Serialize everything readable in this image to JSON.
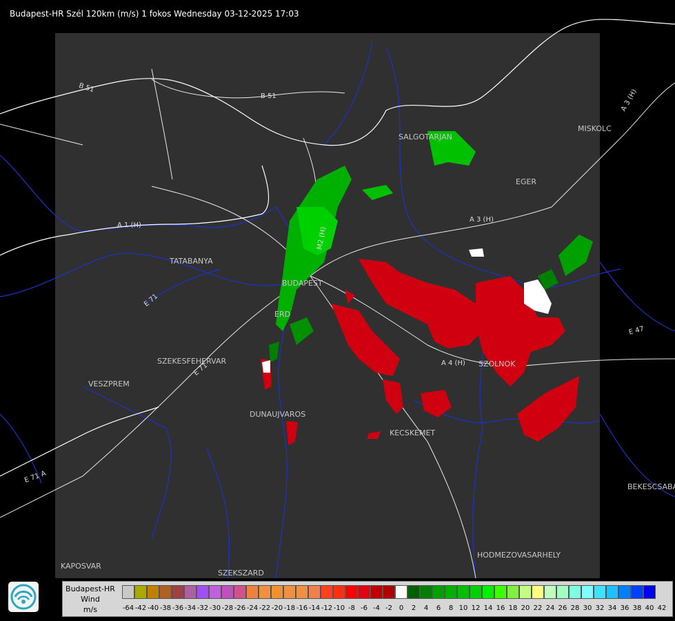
{
  "header": {
    "title": "Budapest-HR Szél 120km (m/s) 1 fokos Wednesday 03-12-2025 17:03"
  },
  "cities": [
    {
      "name": "SALGOTARJAN"
    },
    {
      "name": "EGER"
    },
    {
      "name": "MISKOLC"
    },
    {
      "name": "TATABANYA"
    },
    {
      "name": "BUDAPEST"
    },
    {
      "name": "ERD"
    },
    {
      "name": "SZEKESFEHERVAR"
    },
    {
      "name": "VESZPREM"
    },
    {
      "name": "DUNAUJVAROS"
    },
    {
      "name": "KECSKEMET"
    },
    {
      "name": "SZOLNOK"
    },
    {
      "name": "BEKESCSABA"
    },
    {
      "name": "HODMEZOVASARHELY"
    },
    {
      "name": "KAPOSVAR"
    },
    {
      "name": "SZEKSZARD"
    }
  ],
  "roads": [
    {
      "name": "B 51"
    },
    {
      "name": "B 51"
    },
    {
      "name": "A 1 (H)"
    },
    {
      "name": "A 3 (H)"
    },
    {
      "name": "A 3 (H)"
    },
    {
      "name": "M2 (H)"
    },
    {
      "name": "A 4 (H)"
    },
    {
      "name": "E 71"
    },
    {
      "name": "E 71"
    },
    {
      "name": "E 71 A"
    },
    {
      "name": "E 47"
    }
  ],
  "legend": {
    "station": "Budapest-HR",
    "quantity": "Wind",
    "unit": "m/s",
    "colors": [
      "#c8c8c8",
      "#a9a900",
      "#c08000",
      "#b06020",
      "#a04040",
      "#b060a0",
      "#a050f0",
      "#c060e0",
      "#c050c0",
      "#d05090",
      "#f08040",
      "#f09040",
      "#f09030",
      "#f09040",
      "#f09040",
      "#f08050",
      "#ff4020",
      "#ff3010",
      "#ff0000",
      "#e00010",
      "#c00000",
      "#b00000",
      "#ffffff",
      "#006000",
      "#008000",
      "#00a000",
      "#00b000",
      "#00c000",
      "#00d000",
      "#00f000",
      "#40ff00",
      "#80f040",
      "#c0ff80",
      "#ffff80",
      "#c0ffc0",
      "#a0ffc0",
      "#80ffe0",
      "#80ffff",
      "#40e0ff",
      "#20c0ff",
      "#0080ff",
      "#0040ff",
      "#0000f0"
    ],
    "ticks": [
      "-64",
      "-42",
      "-40",
      "-38",
      "-36",
      "-34",
      "-32",
      "-30",
      "-28",
      "-26",
      "-24",
      "-22",
      "-20",
      "-18",
      "-16",
      "-14",
      "-12",
      "-10",
      "-8",
      "-6",
      "-4",
      "-2",
      "0",
      "2",
      "4",
      "6",
      "8",
      "10",
      "12",
      "14",
      "16",
      "18",
      "20",
      "22",
      "24",
      "26",
      "28",
      "30",
      "32",
      "34",
      "36",
      "38",
      "40",
      "42"
    ]
  }
}
